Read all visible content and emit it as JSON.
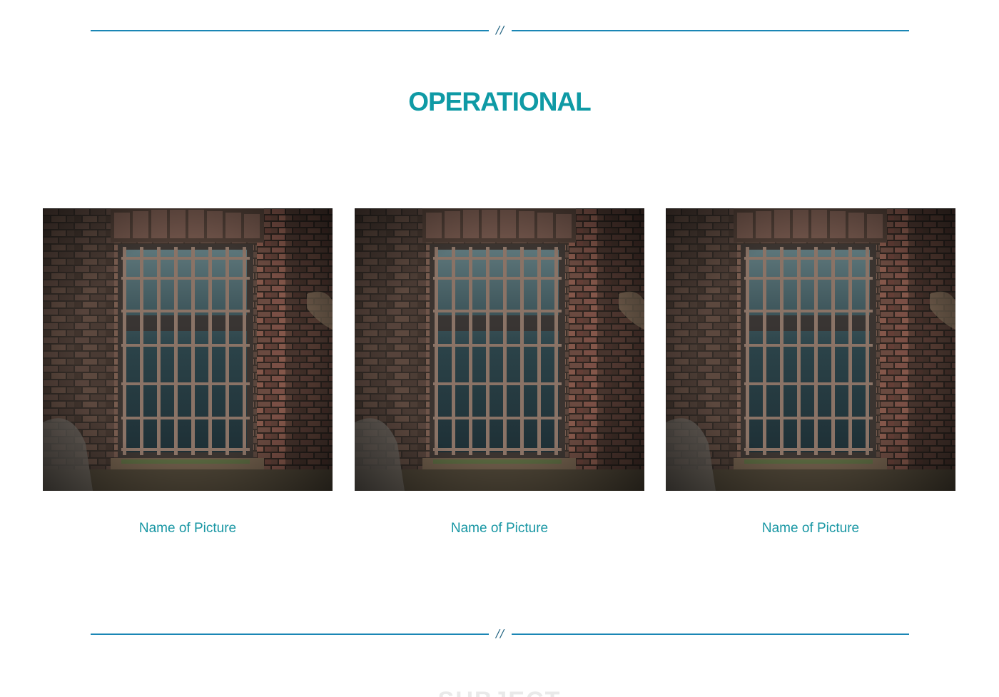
{
  "divider": {
    "mark": "//"
  },
  "section": {
    "title": "OPERATIONAL",
    "accent_color": "#0f9aa5",
    "line_color": "#1a86b5"
  },
  "gallery": {
    "items": [
      {
        "caption": "Name of Picture",
        "image": "barred-window-photo"
      },
      {
        "caption": "Name of Picture",
        "image": "barred-window-photo"
      },
      {
        "caption": "Name of Picture",
        "image": "barred-window-photo"
      }
    ]
  },
  "next_section": {
    "title_partial": "SUBJECT"
  }
}
